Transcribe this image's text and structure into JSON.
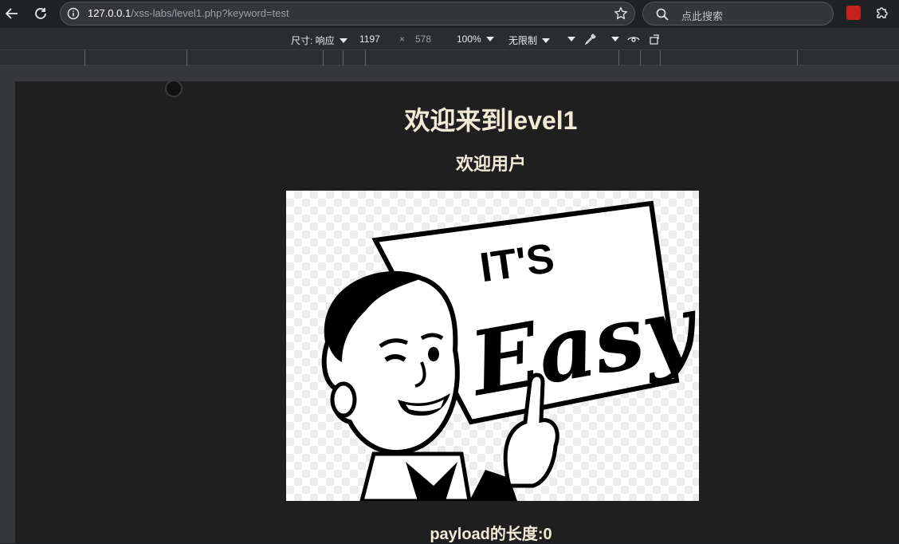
{
  "browser": {
    "url_host": "127.0.0.1",
    "url_path": "/xss-labs/level1.php?keyword=test",
    "search_placeholder": "点此搜索"
  },
  "device_toolbar": {
    "dimensions_label": "尺寸: 响应",
    "width": "1197",
    "times": "×",
    "height": "578",
    "zoom": "100%",
    "throttle": "无限制"
  },
  "page": {
    "title": "欢迎来到level1",
    "subtitle": "欢迎用户",
    "image_text_top": "IT'S",
    "image_text_main": "Easy",
    "payload_label": "payload的长度:0"
  }
}
